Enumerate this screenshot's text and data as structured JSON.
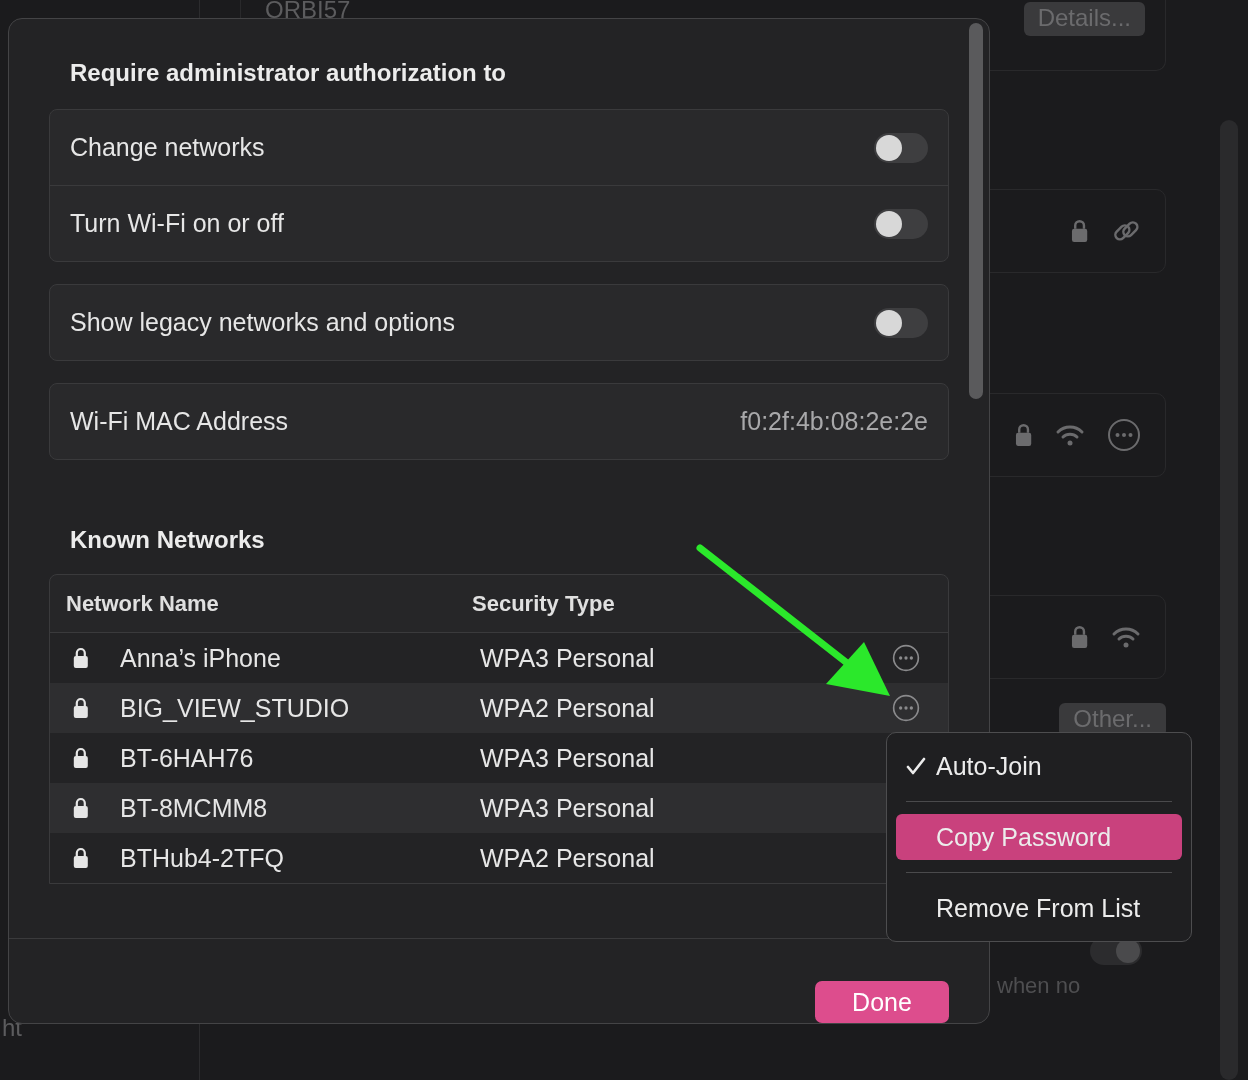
{
  "background": {
    "top_network": "ORBI57",
    "details_button": "Details...",
    "network_rows": [
      {
        "kind": "link"
      },
      {
        "kind": "more"
      },
      {
        "kind": "wifi"
      }
    ],
    "other_button": "Other...",
    "toggle": {
      "on": true
    },
    "caption": "when no",
    "sidebar_text": "ht"
  },
  "dialog": {
    "section_title": "Require administrator authorization to",
    "settings_groups": [
      [
        {
          "kind": "toggle",
          "label": "Change networks",
          "on": false
        },
        {
          "kind": "toggle",
          "label": "Turn Wi-Fi on or off",
          "on": false
        }
      ],
      [
        {
          "kind": "toggle",
          "label": "Show legacy networks and options",
          "on": false
        }
      ],
      [
        {
          "kind": "value",
          "label": "Wi-Fi MAC Address",
          "value": "f0:2f:4b:08:2e:2e"
        }
      ]
    ],
    "known_networks_title": "Known Networks",
    "table": {
      "columns": [
        "Network Name",
        "Security Type"
      ],
      "rows": [
        {
          "name": "Anna’s iPhone",
          "security": "WPA3 Personal",
          "more_button": true
        },
        {
          "name": "BIG_VIEW_STUDIO",
          "security": "WPA2 Personal",
          "more_button": true
        },
        {
          "name": "BT-6HAH76",
          "security": "WPA3 Personal",
          "more_button": false
        },
        {
          "name": "BT-8MCMM8",
          "security": "WPA3 Personal",
          "more_button": false
        },
        {
          "name": "BTHub4-2TFQ",
          "security": "WPA2 Personal",
          "more_button": false
        }
      ]
    },
    "done_button": "Done"
  },
  "context_menu": [
    {
      "label": "Auto-Join",
      "checked": true,
      "highlighted": false
    },
    {
      "label": "Copy Password",
      "checked": false,
      "highlighted": true
    },
    {
      "label": "Remove From List",
      "checked": false,
      "highlighted": false
    }
  ]
}
